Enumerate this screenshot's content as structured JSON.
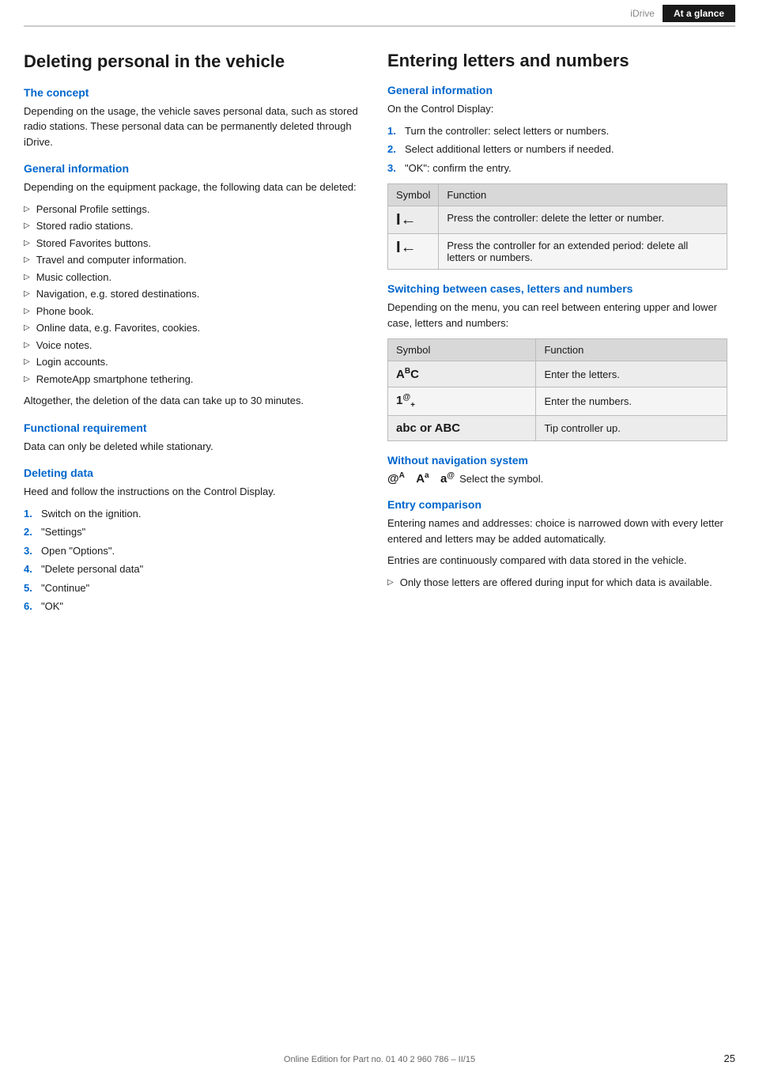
{
  "header": {
    "idrive_label": "iDrive",
    "tab_label": "At a glance"
  },
  "left": {
    "main_title": "Deleting personal in the vehicle",
    "concept": {
      "heading": "The concept",
      "body": "Depending on the usage, the vehicle saves personal data, such as stored radio stations. These personal data can be permanently deleted through iDrive."
    },
    "general_info": {
      "heading": "General information",
      "body": "Depending on the equipment package, the following data can be deleted:",
      "bullets": [
        "Personal Profile settings.",
        "Stored radio stations.",
        "Stored Favorites buttons.",
        "Travel and computer information.",
        "Music collection.",
        "Navigation, e.g. stored destinations.",
        "Phone book.",
        "Online data, e.g. Favorites, cookies.",
        "Voice notes.",
        "Login accounts.",
        "RemoteApp smartphone tethering."
      ],
      "footer_text": "Altogether, the deletion of the data can take up to 30 minutes."
    },
    "functional_requirement": {
      "heading": "Functional requirement",
      "body": "Data can only be deleted while stationary."
    },
    "deleting_data": {
      "heading": "Deleting data",
      "body": "Heed and follow the instructions on the Control Display.",
      "steps": [
        {
          "num": "1.",
          "text": "Switch on the ignition."
        },
        {
          "num": "2.",
          "text": "\"Settings\""
        },
        {
          "num": "3.",
          "text": "Open \"Options\"."
        },
        {
          "num": "4.",
          "text": "\"Delete personal data\""
        },
        {
          "num": "5.",
          "text": "\"Continue\""
        },
        {
          "num": "6.",
          "text": "\"OK\""
        }
      ]
    }
  },
  "right": {
    "main_title": "Entering letters and numbers",
    "general_info": {
      "heading": "General information",
      "body": "On the Control Display:",
      "steps": [
        {
          "num": "1.",
          "text": "Turn the controller: select letters or numbers."
        },
        {
          "num": "2.",
          "text": "Select additional letters or numbers if needed."
        },
        {
          "num": "3.",
          "text": "\"OK\": confirm the entry."
        }
      ],
      "table": {
        "col1": "Symbol",
        "col2": "Function",
        "rows": [
          {
            "symbol": "I←",
            "function": "Press the controller: delete the letter or number."
          },
          {
            "symbol": "I←",
            "function": "Press the controller for an extended period: delete all letters or numbers."
          }
        ]
      }
    },
    "switching": {
      "heading": "Switching between cases, letters and numbers",
      "body": "Depending on the menu, you can reel between entering upper and lower case, letters and numbers:",
      "table": {
        "col1": "Symbol",
        "col2": "Function",
        "rows": [
          {
            "symbol": "ABC",
            "symbol_type": "abc",
            "function": "Enter the letters."
          },
          {
            "symbol": "1@+",
            "symbol_type": "num",
            "function": "Enter the numbers."
          },
          {
            "symbol": "abc or ABC",
            "symbol_type": "plain",
            "function": "Tip controller up."
          }
        ]
      }
    },
    "without_nav": {
      "heading": "Without navigation system",
      "symbols_text": "Select the symbol."
    },
    "entry_comparison": {
      "heading": "Entry comparison",
      "body1": "Entering names and addresses: choice is narrowed down with every letter entered and letters may be added automatically.",
      "body2": "Entries are continuously compared with data stored in the vehicle.",
      "bullet": "Only those letters are offered during input for which data is available."
    }
  },
  "footer": {
    "text": "Online Edition for Part no. 01 40 2 960 786 – II/15",
    "page": "25"
  }
}
